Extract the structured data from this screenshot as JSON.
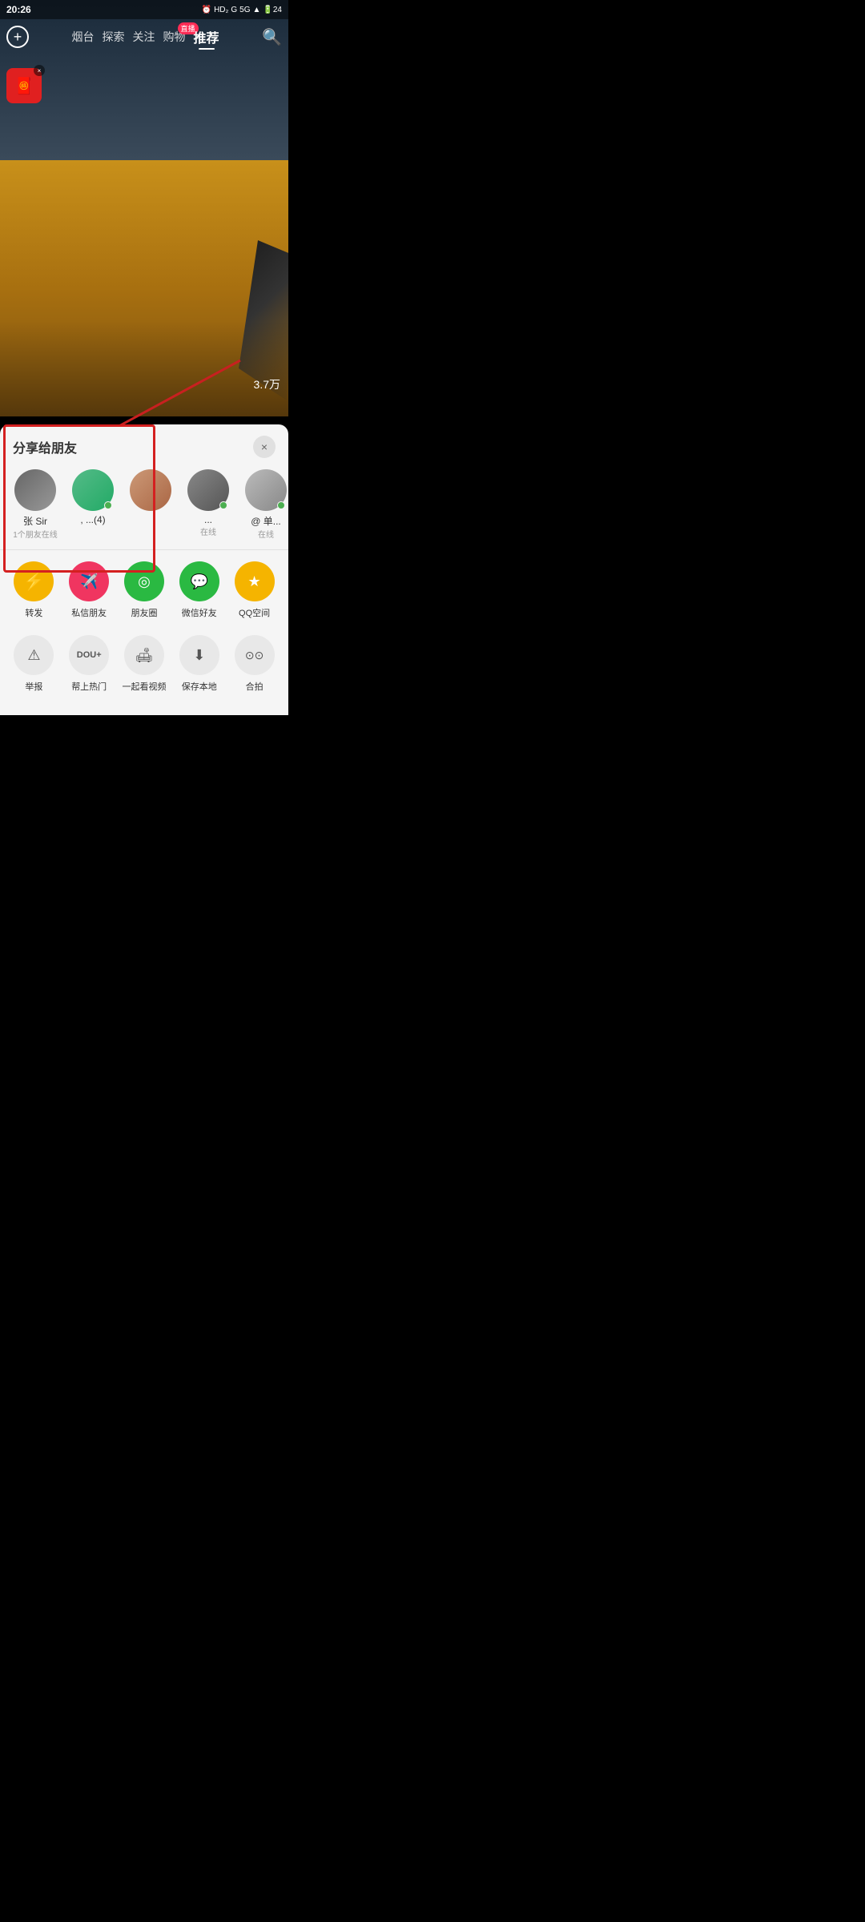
{
  "statusBar": {
    "time": "20:26",
    "rightIcons": "HD₂ G 5G ▲ 24"
  },
  "nav": {
    "tabs": [
      {
        "label": "烟台",
        "active": false
      },
      {
        "label": "探索",
        "active": false
      },
      {
        "label": "关注",
        "active": false
      },
      {
        "label": "购物",
        "active": false,
        "badge": "直播"
      },
      {
        "label": "推荐",
        "active": true
      }
    ],
    "searchIcon": "🔍"
  },
  "video": {
    "likeCount": "3.7万"
  },
  "shareSheet": {
    "title": "分享给朋友",
    "closeLabel": "×",
    "friends": [
      {
        "name": "张 Sir",
        "sub": "1个朋友在线",
        "hasOnline": false,
        "avClass": "av1"
      },
      {
        "name": ", ...(4)",
        "sub": "",
        "hasOnline": true,
        "avClass": "av2"
      },
      {
        "name": "",
        "sub": "",
        "hasOnline": false,
        "avClass": "av3"
      },
      {
        "name": "...",
        "sub": "在线",
        "hasOnline": true,
        "avClass": "av4"
      },
      {
        "name": "@  单...",
        "sub": "在线",
        "hasOnline": true,
        "avClass": "av5"
      }
    ],
    "actions1": [
      {
        "label": "转发",
        "icon": "⚡",
        "colorClass": "action-circle-yellow"
      },
      {
        "label": "私信朋友",
        "icon": "✈",
        "colorClass": "action-circle-red"
      },
      {
        "label": "朋友圈",
        "icon": "◎",
        "colorClass": "action-circle-green"
      },
      {
        "label": "微信好友",
        "icon": "💬",
        "colorClass": "action-circle-wechat"
      },
      {
        "label": "QQ空间",
        "icon": "★",
        "colorClass": "action-circle-qq"
      }
    ],
    "actions2": [
      {
        "label": "举报",
        "icon": "⚠",
        "colorClass": "action-circle-gray"
      },
      {
        "label": "帮上热门",
        "icon": "DOU+",
        "colorClass": "action-circle-gray",
        "isText": true
      },
      {
        "label": "一起看视频",
        "icon": "🛋",
        "colorClass": "action-circle-gray"
      },
      {
        "label": "保存本地",
        "icon": "⬇",
        "colorClass": "action-circle-gray"
      },
      {
        "label": "合拍",
        "icon": "◎◎",
        "colorClass": "action-circle-gray"
      }
    ]
  },
  "bottomNav": {
    "icons": [
      "☰",
      "⌂",
      "↩"
    ]
  }
}
